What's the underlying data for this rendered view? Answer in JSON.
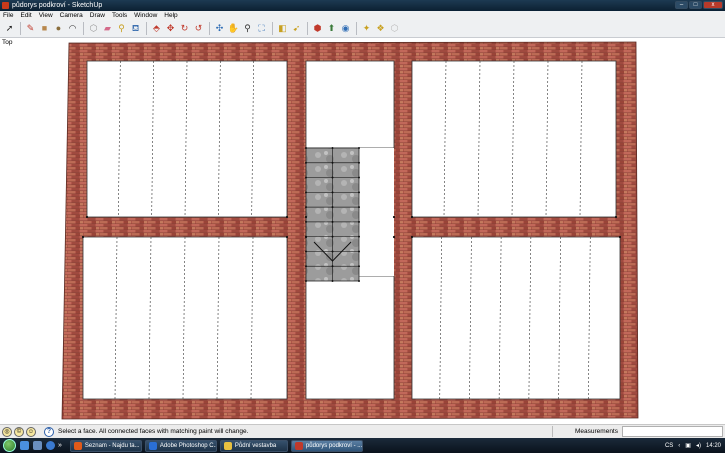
{
  "window": {
    "title": "půdorys podkroví - SketchUp",
    "minimize": "–",
    "maximize": "□",
    "close": "x"
  },
  "menu": [
    "File",
    "Edit",
    "View",
    "Camera",
    "Draw",
    "Tools",
    "Window",
    "Help"
  ],
  "toolbar": [
    {
      "icon": "select-arrow-icon",
      "glyph": "➚",
      "color": "#222"
    },
    {
      "sep": true
    },
    {
      "icon": "pencil-icon",
      "glyph": "✎",
      "color": "#c0392b"
    },
    {
      "icon": "rectangle-icon",
      "glyph": "■",
      "color": "#b8874c"
    },
    {
      "icon": "circle-icon",
      "glyph": "●",
      "color": "#8a6d3b"
    },
    {
      "icon": "arc-icon",
      "glyph": "◠",
      "color": "#333"
    },
    {
      "sep": true
    },
    {
      "icon": "make-component-icon",
      "glyph": "⬡",
      "color": "#999"
    },
    {
      "icon": "eraser-icon",
      "glyph": "▰",
      "color": "#d46a8a"
    },
    {
      "icon": "tape-measure-icon",
      "glyph": "⚲",
      "color": "#c8a020"
    },
    {
      "icon": "paint-bucket-icon",
      "glyph": "⛾",
      "color": "#3a6fb0"
    },
    {
      "sep": true
    },
    {
      "icon": "push-pull-icon",
      "glyph": "⬘",
      "color": "#c0392b"
    },
    {
      "icon": "move-icon",
      "glyph": "✥",
      "color": "#c0392b"
    },
    {
      "icon": "rotate-icon",
      "glyph": "↻",
      "color": "#c0392b"
    },
    {
      "icon": "offset-icon",
      "glyph": "↺",
      "color": "#c0392b"
    },
    {
      "sep": true
    },
    {
      "icon": "orbit-icon",
      "glyph": "✣",
      "color": "#2f6db5"
    },
    {
      "icon": "pan-icon",
      "glyph": "✋",
      "color": "#b07a4a"
    },
    {
      "icon": "zoom-icon",
      "glyph": "⚲",
      "color": "#333"
    },
    {
      "icon": "zoom-extents-icon",
      "glyph": "⛶",
      "color": "#2f6db5"
    },
    {
      "sep": true
    },
    {
      "icon": "previous-view-icon",
      "glyph": "◧",
      "color": "#c8a020"
    },
    {
      "icon": "next-view-icon",
      "glyph": "➹",
      "color": "#c8a020"
    },
    {
      "sep": true
    },
    {
      "icon": "get-models-icon",
      "glyph": "⬢",
      "color": "#c0392b"
    },
    {
      "icon": "share-model-icon",
      "glyph": "⬆",
      "color": "#3a7a3a"
    },
    {
      "icon": "google-earth-icon",
      "glyph": "◉",
      "color": "#2f6db5"
    },
    {
      "sep": true
    },
    {
      "icon": "get-current-view-icon",
      "glyph": "✦",
      "color": "#c8a020"
    },
    {
      "icon": "toggle-terrain-icon",
      "glyph": "❖",
      "color": "#c8a020"
    },
    {
      "icon": "place-model-icon",
      "glyph": "⬡",
      "color": "#bbb"
    }
  ],
  "viewport": {
    "view_name": "Top"
  },
  "colors": {
    "wall": "#b0564a",
    "wall_line": "#6b2a22",
    "stair_fill": "#9a9a9a",
    "room_fill": "#ffffff"
  },
  "status": {
    "hint": "Select a face.  All connected faces with matching paint will change.",
    "measurements_label": "Measurements",
    "measurements_value": ""
  },
  "taskbar": {
    "buttons": [
      {
        "label": "Seznam - Najdu ta...",
        "icon_color": "#e05a1a"
      },
      {
        "label": "Adobe Photoshop C...",
        "icon_color": "#2a6fd6"
      },
      {
        "label": "Půdní vestavba",
        "icon_color": "#e8c040"
      },
      {
        "label": "půdorys podkroví - ...",
        "icon_color": "#c0392b",
        "active": true
      }
    ],
    "lang": "CS",
    "time": "14:20"
  }
}
